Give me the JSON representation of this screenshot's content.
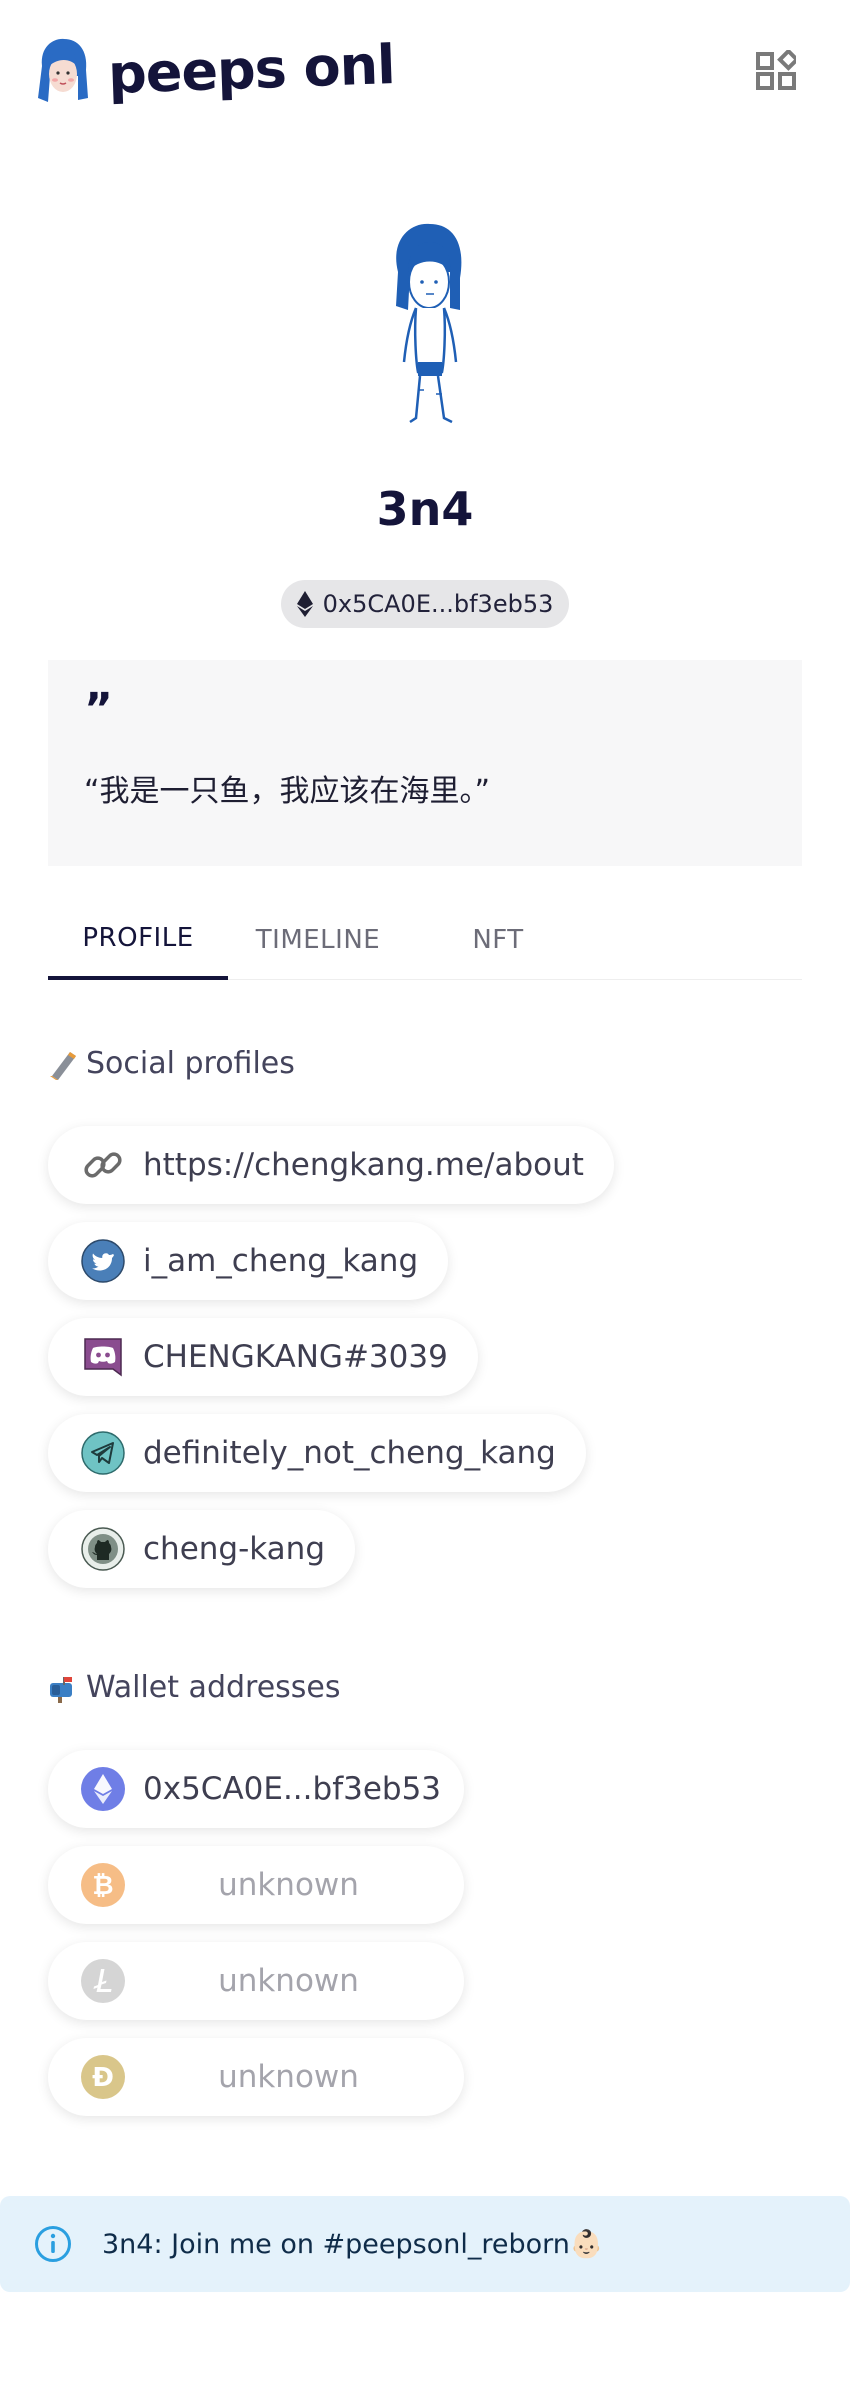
{
  "header": {
    "logo_text": "peeps onl",
    "logo_icon": "peep-avatar-icon",
    "qr_icon": "qr-code-icon"
  },
  "profile": {
    "name": "3n4",
    "address_short": "0x5CA0E...bf3eb53",
    "quote_mark": "”",
    "quote": "“我是一只鱼，我应该在海里。”"
  },
  "tabs": [
    {
      "label": "PROFILE",
      "active": true
    },
    {
      "label": "TIMELINE",
      "active": false
    },
    {
      "label": "NFT",
      "active": false
    }
  ],
  "social": {
    "title": "Social profiles",
    "title_icon": "phone-emoji",
    "items": [
      {
        "icon": "link-icon",
        "text": "https://chengkang.me/about",
        "color": "#6b6b6b"
      },
      {
        "icon": "twitter-icon",
        "text": "i_am_cheng_kang",
        "color": "#4a7fb8"
      },
      {
        "icon": "discord-icon",
        "text": "CHENGKANG#3039",
        "color": "#8a4c8f"
      },
      {
        "icon": "telegram-icon",
        "text": "definitely_not_cheng_kang",
        "color": "#6fc3c4"
      },
      {
        "icon": "github-icon",
        "text": "cheng-kang",
        "color": "#7f8f86"
      }
    ]
  },
  "wallets": {
    "title": "Wallet addresses",
    "title_icon": "mailbox-emoji",
    "items": [
      {
        "icon": "ethereum-icon",
        "text": "0x5CA0E...bf3eb53",
        "color": "#6f7ee6",
        "known": true
      },
      {
        "icon": "bitcoin-icon",
        "text": "unknown",
        "color": "#f6bd86",
        "known": false
      },
      {
        "icon": "litecoin-icon",
        "text": "unknown",
        "color": "#d5d5d5",
        "known": false
      },
      {
        "icon": "dogecoin-icon",
        "text": "unknown",
        "color": "#d9c68a",
        "known": false
      }
    ]
  },
  "banner": {
    "text": "3n4: Join me on #peepsonl_reborn",
    "emoji": "👶🏻",
    "color": "#e4f2fb"
  }
}
